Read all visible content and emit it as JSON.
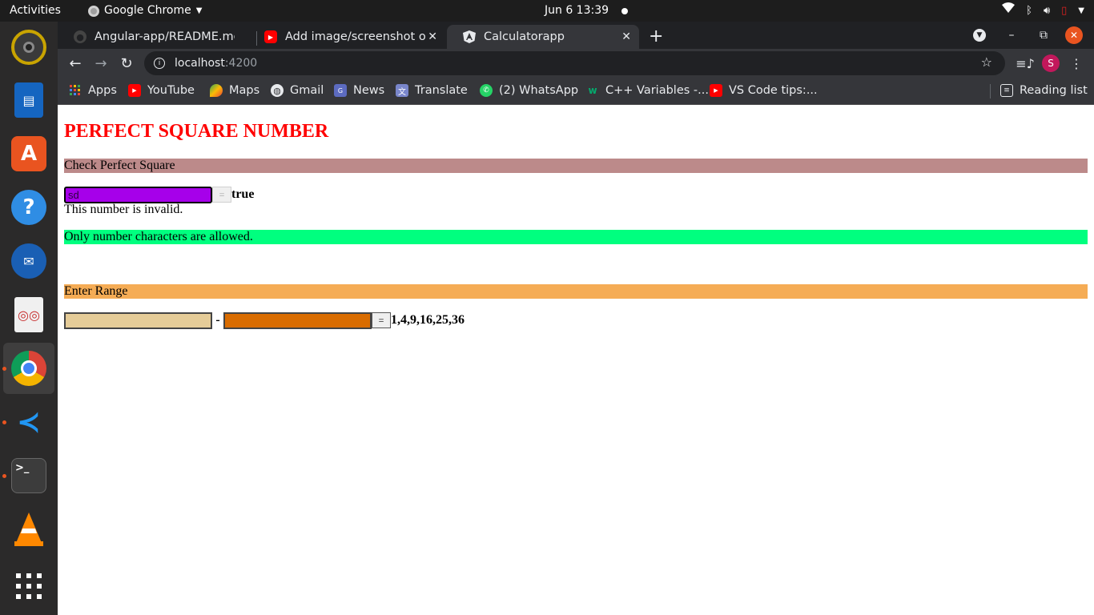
{
  "system": {
    "activities": "Activities",
    "app_name": "Google Chrome",
    "clock": "Jun 6  13:39"
  },
  "dock": {
    "apps": [
      "rhythmbox-icon",
      "writer-icon",
      "software-icon",
      "help-icon",
      "thunderbird-icon",
      "document-viewer-icon",
      "chrome-icon",
      "vscode-icon",
      "terminal-icon",
      "vlc-icon",
      "show-apps-icon"
    ],
    "active": "chrome"
  },
  "browser": {
    "tabs": [
      {
        "title": "Angular-app/README.md",
        "icon": "github-icon"
      },
      {
        "title": "Add image/screenshot of",
        "icon": "youtube-icon"
      },
      {
        "title": "Calculatorapp",
        "icon": "angular-icon"
      }
    ],
    "url_host": "localhost",
    "url_port": ":4200",
    "profile_initial": "S",
    "bookmarks": [
      {
        "label": "Apps",
        "icon": "apps-grid-icon"
      },
      {
        "label": "YouTube",
        "icon": "youtube-icon"
      },
      {
        "label": "Maps",
        "icon": "maps-icon"
      },
      {
        "label": "Gmail",
        "icon": "globe-icon"
      },
      {
        "label": "News",
        "icon": "news-icon"
      },
      {
        "label": "Translate",
        "icon": "translate-icon"
      },
      {
        "label": "(2) WhatsApp",
        "icon": "whatsapp-icon"
      },
      {
        "label": "C++ Variables -...",
        "icon": "w3schools-icon"
      },
      {
        "label": "VS Code tips:...",
        "icon": "youtube-icon"
      }
    ],
    "reading_list": "Reading list"
  },
  "page": {
    "title": "PERFECT SQUARE NUMBER",
    "check_section": {
      "header": "Check Perfect Square",
      "input_value": "sd",
      "equals_label": "=",
      "result": "true",
      "invalid_message": "This number is invalid.",
      "notice": "Only number characters are allowed."
    },
    "range_section": {
      "header": "Enter Range",
      "from_value": "",
      "to_value": "",
      "dash": "-",
      "equals_label": "=",
      "result": "1,4,9,16,25,36"
    }
  },
  "colors": {
    "title": "#ff0000",
    "check_header_bg": "#bc8a8a",
    "check_input_bg": "#a600ea",
    "notice_bg": "#00ff7f",
    "range_header_bg": "#f5ac55",
    "range_from_bg": "#e5cc98",
    "range_to_bg": "#d96c00"
  }
}
